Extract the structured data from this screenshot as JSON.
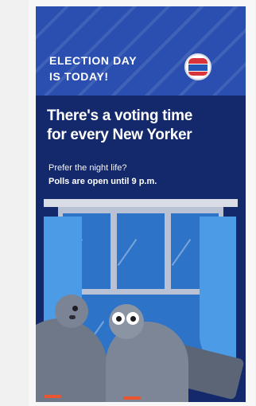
{
  "banner": {
    "line1": "ELECTION DAY",
    "line2": "IS TODAY!",
    "sticker_icon": "i-voted-sticker-icon"
  },
  "headline": {
    "line1": "There's a voting time",
    "line2": "for every New Yorker"
  },
  "subtext": {
    "question": "Prefer the night life?",
    "statement": "Polls are open until 9 p.m."
  },
  "colors": {
    "background": "#14296b",
    "banner": "#2a4fb0",
    "window_glass": "#2d74c8",
    "curtain": "#4c9be6"
  }
}
